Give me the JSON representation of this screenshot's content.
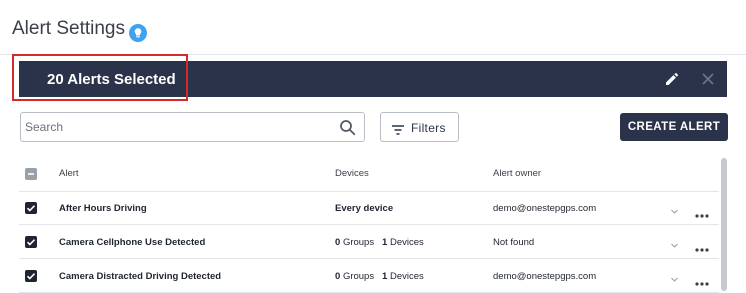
{
  "page": {
    "title": "Alert Settings"
  },
  "banner": {
    "selected_text": "20 Alerts Selected"
  },
  "search": {
    "placeholder": "Search"
  },
  "toolbar": {
    "filters_label": "Filters",
    "create_label": "CREATE ALERT"
  },
  "table": {
    "columns": {
      "alert": "Alert",
      "devices": "Devices",
      "owner": "Alert owner"
    },
    "rows": [
      {
        "name": "After Hours Driving",
        "devices": "Every device",
        "groups_count": "",
        "groups_label": "",
        "devices_count": "",
        "devices_label": "",
        "owner": "demo@onestepgps.com"
      },
      {
        "name": "Camera Cellphone Use Detected",
        "devices": "",
        "groups_count": "0",
        "groups_label": "Groups",
        "devices_count": "1",
        "devices_label": "Devices",
        "owner": "Not found"
      },
      {
        "name": "Camera Distracted Driving Detected",
        "devices": "",
        "groups_count": "0",
        "groups_label": "Groups",
        "devices_count": "1",
        "devices_label": "Devices",
        "owner": "demo@onestepgps.com"
      }
    ]
  },
  "icons": {
    "help": "lightbulb-icon",
    "edit": "pencil-icon",
    "close": "close-icon",
    "search": "search-icon",
    "filter": "filter-icon",
    "chevron": "chevron-down-icon",
    "more": "more-horizontal-icon"
  },
  "colors": {
    "banner_bg": "#2a3349",
    "accent_blue": "#3da3f0",
    "highlight": "#d62a2a"
  }
}
